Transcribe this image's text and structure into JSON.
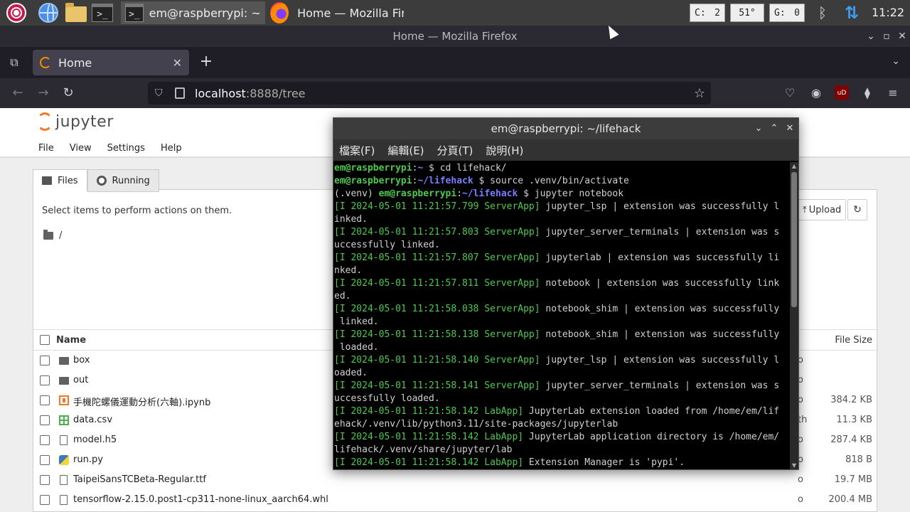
{
  "taskbar": {
    "task_terminal_label": "em@raspberrypi: ~/li...",
    "task_firefox_label": "Home — Mozilla Fire..",
    "cpu_label": "C:",
    "cpu_value": "2",
    "temp_value": "51°",
    "gpu_label": "G:",
    "gpu_value": "0",
    "clock": "11:22"
  },
  "firefox": {
    "window_title": "Home — Mozilla Firefox",
    "tab_title": "Home",
    "url_host": "localhost",
    "url_rest": ":8888/tree"
  },
  "jupyter": {
    "logo_text": "jupyter",
    "menu": [
      "File",
      "View",
      "Settings",
      "Help"
    ],
    "tabs": [
      "Files",
      "Running"
    ],
    "hint": "Select items to perform actions on them.",
    "path": "/",
    "upload_label": "Upload",
    "col_name": "Name",
    "col_size": "File Size",
    "files": [
      {
        "name": "box",
        "type": "folder",
        "modified": "o",
        "size": ""
      },
      {
        "name": "out",
        "type": "folder",
        "modified": "o",
        "size": ""
      },
      {
        "name": "手機陀螺儀運動分析(六軸).ipynb",
        "type": "notebook",
        "modified": "o",
        "size": "384.2 KB"
      },
      {
        "name": "data.csv",
        "type": "csv",
        "modified": "th",
        "size": "11.3 KB"
      },
      {
        "name": "model.h5",
        "type": "file",
        "modified": "o",
        "size": "287.4 KB"
      },
      {
        "name": "run.py",
        "type": "python",
        "modified": "o",
        "size": "818 B"
      },
      {
        "name": "TaipeiSansTCBeta-Regular.ttf",
        "type": "file",
        "modified": "o",
        "size": "19.7 MB"
      },
      {
        "name": "tensorflow-2.15.0.post1-cp311-none-linux_aarch64.whl",
        "type": "file",
        "modified": "o",
        "size": "200.4 MB"
      }
    ]
  },
  "terminal": {
    "title": "em@raspberrypi: ~/lifehack",
    "menu": [
      "檔案(F)",
      "編輯(E)",
      "分頁(T)",
      "說明(H)"
    ],
    "lines": [
      {
        "parts": [
          {
            "t": "em@raspberrypi",
            "c": "g"
          },
          {
            "t": ":",
            "c": ""
          },
          {
            "t": "~",
            "c": "b"
          },
          {
            "t": " $ cd lifehack/",
            "c": ""
          }
        ]
      },
      {
        "parts": [
          {
            "t": "em@raspberrypi",
            "c": "g"
          },
          {
            "t": ":",
            "c": ""
          },
          {
            "t": "~/lifehack",
            "c": "b"
          },
          {
            "t": " $ source .venv/bin/activate",
            "c": ""
          }
        ]
      },
      {
        "parts": [
          {
            "t": "(.venv) ",
            "c": ""
          },
          {
            "t": "em@raspberrypi",
            "c": "g"
          },
          {
            "t": ":",
            "c": ""
          },
          {
            "t": "~/lifehack",
            "c": "b"
          },
          {
            "t": " $ jupyter notebook",
            "c": ""
          }
        ]
      },
      {
        "parts": [
          {
            "t": "[I 2024-05-01 11:21:57.799 ServerApp]",
            "c": "gl"
          },
          {
            "t": " jupyter_lsp | extension was successfully l",
            "c": ""
          }
        ]
      },
      {
        "parts": [
          {
            "t": "inked.",
            "c": ""
          }
        ]
      },
      {
        "parts": [
          {
            "t": "[I 2024-05-01 11:21:57.803 ServerApp]",
            "c": "gl"
          },
          {
            "t": " jupyter_server_terminals | extension was s",
            "c": ""
          }
        ]
      },
      {
        "parts": [
          {
            "t": "uccessfully linked.",
            "c": ""
          }
        ]
      },
      {
        "parts": [
          {
            "t": "[I 2024-05-01 11:21:57.807 ServerApp]",
            "c": "gl"
          },
          {
            "t": " jupyterlab | extension was successfully li",
            "c": ""
          }
        ]
      },
      {
        "parts": [
          {
            "t": "nked.",
            "c": ""
          }
        ]
      },
      {
        "parts": [
          {
            "t": "[I 2024-05-01 11:21:57.811 ServerApp]",
            "c": "gl"
          },
          {
            "t": " notebook | extension was successfully link",
            "c": ""
          }
        ]
      },
      {
        "parts": [
          {
            "t": "ed.",
            "c": ""
          }
        ]
      },
      {
        "parts": [
          {
            "t": "[I 2024-05-01 11:21:58.038 ServerApp]",
            "c": "gl"
          },
          {
            "t": " notebook_shim | extension was successfully",
            "c": ""
          }
        ]
      },
      {
        "parts": [
          {
            "t": " linked.",
            "c": ""
          }
        ]
      },
      {
        "parts": [
          {
            "t": "[I 2024-05-01 11:21:58.138 ServerApp]",
            "c": "gl"
          },
          {
            "t": " notebook_shim | extension was successfully",
            "c": ""
          }
        ]
      },
      {
        "parts": [
          {
            "t": " loaded.",
            "c": ""
          }
        ]
      },
      {
        "parts": [
          {
            "t": "[I 2024-05-01 11:21:58.140 ServerApp]",
            "c": "gl"
          },
          {
            "t": " jupyter_lsp | extension was successfully l",
            "c": ""
          }
        ]
      },
      {
        "parts": [
          {
            "t": "oaded.",
            "c": ""
          }
        ]
      },
      {
        "parts": [
          {
            "t": "[I 2024-05-01 11:21:58.141 ServerApp]",
            "c": "gl"
          },
          {
            "t": " jupyter_server_terminals | extension was s",
            "c": ""
          }
        ]
      },
      {
        "parts": [
          {
            "t": "uccessfully loaded.",
            "c": ""
          }
        ]
      },
      {
        "parts": [
          {
            "t": "[I 2024-05-01 11:21:58.142 LabApp]",
            "c": "gl"
          },
          {
            "t": " JupyterLab extension loaded from /home/em/lif",
            "c": ""
          }
        ]
      },
      {
        "parts": [
          {
            "t": "ehack/.venv/lib/python3.11/site-packages/jupyterlab",
            "c": ""
          }
        ]
      },
      {
        "parts": [
          {
            "t": "[I 2024-05-01 11:21:58.142 LabApp]",
            "c": "gl"
          },
          {
            "t": " JupyterLab application directory is /home/em/",
            "c": ""
          }
        ]
      },
      {
        "parts": [
          {
            "t": "lifehack/.venv/share/jupyter/lab",
            "c": ""
          }
        ]
      },
      {
        "parts": [
          {
            "t": "[I 2024-05-01 11:21:58.142 LabApp]",
            "c": "gl"
          },
          {
            "t": " Extension Manager is 'pypi'.",
            "c": ""
          }
        ]
      }
    ]
  }
}
